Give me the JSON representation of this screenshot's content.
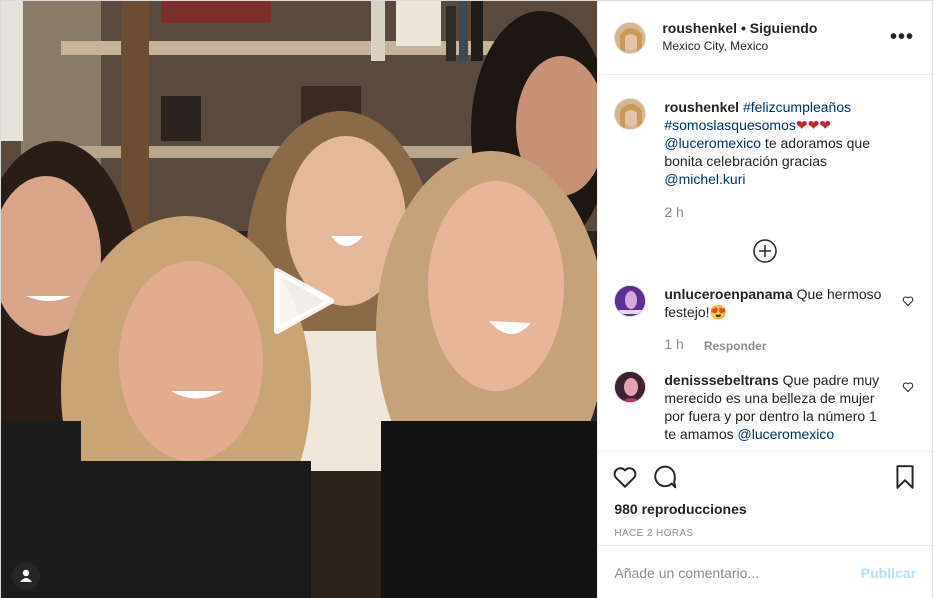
{
  "post": {
    "author": "roushenkel",
    "follow_state": "• Siguiendo",
    "location": "Mexico City, Mexico",
    "more_label": "•••"
  },
  "caption": {
    "username": "roushenkel",
    "hashtag1": "#felizcumpleaños",
    "hashtag2": "#somoslasquesomos",
    "hearts": "❤❤❤",
    "mention1": "@luceromexico",
    "text": " te adoramos que bonita celebración gracias ",
    "mention2": "@michel.kuri",
    "time": "2 h"
  },
  "comments": [
    {
      "username": "unluceroenpanama",
      "text": " Que hermoso festejo!",
      "emoji": "😍",
      "time": "1 h",
      "reply_label": "Responder"
    },
    {
      "username": "denisssebeltrans",
      "text": " Que padre muy merecido es una belleza de mujer por fuera y por dentro la número 1 te amamos ",
      "mention": "@luceromexico"
    }
  ],
  "stats": {
    "views": "980 reproducciones",
    "posted": "HACE 2 HORAS"
  },
  "comment_box": {
    "placeholder": "Añade un comentario...",
    "publish_label": "Publicar"
  },
  "colors": {
    "link": "#003569",
    "muted": "#8e8e8e",
    "publish_disabled": "#b2dffc",
    "border": "#dbdbdb"
  },
  "icons": {
    "like": "heart-icon",
    "comment": "comment-bubble-icon",
    "save": "bookmark-icon",
    "play": "play-icon",
    "load_more": "plus-circle-icon",
    "user_tag": "user-icon"
  }
}
